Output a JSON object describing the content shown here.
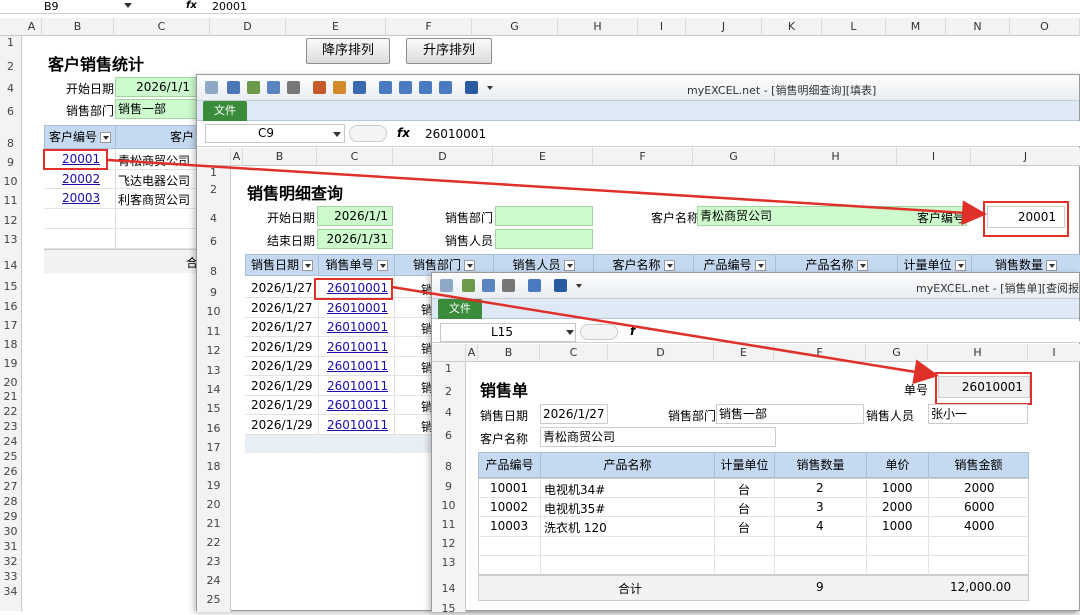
{
  "sheet1": {
    "cell_ref": "B9",
    "formula_value": "20001",
    "columns": [
      "A",
      "B",
      "C",
      "D",
      "E",
      "F",
      "G",
      "H",
      "I",
      "J",
      "K",
      "L",
      "M",
      "N",
      "O"
    ],
    "rows": [
      "1",
      "2",
      "4",
      "6",
      "8",
      "9",
      "10",
      "11",
      "12",
      "13",
      "14",
      "15",
      "16",
      "17",
      "18",
      "19",
      "20",
      "21",
      "22",
      "23",
      "24",
      "25",
      "26",
      "27",
      "28",
      "29",
      "30",
      "31",
      "32",
      "33",
      "34"
    ],
    "title": "客户销售统计",
    "start_label": "开始日期",
    "start_value": "2026/1/1",
    "dept_label": "销售部门",
    "dept_value": "销售一部",
    "btn_desc": "降序排列",
    "btn_asc": "升序排列",
    "hdr_code": "客户编号",
    "hdr_name": "客户",
    "customers": [
      {
        "code": "20001",
        "name": "青松商贸公司"
      },
      {
        "code": "20002",
        "name": "飞达电器公司"
      },
      {
        "code": "20003",
        "name": "利客商贸公司"
      }
    ],
    "total": "合"
  },
  "win2": {
    "title": "myEXCEL.net - [销售明细查询][填表]",
    "file_tab": "文件",
    "cell_ref": "C9",
    "formula_value": "26010001",
    "columns": [
      "A",
      "B",
      "C",
      "D",
      "E",
      "F",
      "G",
      "H",
      "I",
      "J"
    ],
    "rows": [
      "1",
      "2",
      "4",
      "6",
      "8",
      "9",
      "10",
      "11",
      "12",
      "13",
      "14",
      "15",
      "16",
      "17",
      "18",
      "19",
      "20",
      "21",
      "22",
      "23",
      "24",
      "25",
      "26"
    ],
    "title_text": "销售明细查询",
    "start_label": "开始日期",
    "start_value": "2026/1/1",
    "end_label": "结束日期",
    "end_value": "2026/1/31",
    "dept_label": "销售部门",
    "person_label": "销售人员",
    "cust_label": "客户名称",
    "cust_value": "青松商贸公司",
    "code_label": "客户编号",
    "code_value": "20001",
    "headers": [
      "销售日期",
      "销售单号",
      "销售部门",
      "销售人员",
      "客户名称",
      "产品编号",
      "产品名称",
      "计量单位",
      "销售数量"
    ],
    "records": [
      {
        "date": "2026/1/27",
        "no": "26010001",
        "dept": "销"
      },
      {
        "date": "2026/1/27",
        "no": "26010001",
        "dept": "销"
      },
      {
        "date": "2026/1/27",
        "no": "26010001",
        "dept": "销"
      },
      {
        "date": "2026/1/29",
        "no": "26010011",
        "dept": "销"
      },
      {
        "date": "2026/1/29",
        "no": "26010011",
        "dept": "销"
      },
      {
        "date": "2026/1/29",
        "no": "26010011",
        "dept": "销"
      },
      {
        "date": "2026/1/29",
        "no": "26010011",
        "dept": "销"
      },
      {
        "date": "2026/1/29",
        "no": "26010011",
        "dept": "销"
      }
    ]
  },
  "win3": {
    "title": "myEXCEL.net - [销售单][查阅报表",
    "file_tab": "文件",
    "cell_ref": "L15",
    "columns": [
      "A",
      "B",
      "C",
      "D",
      "E",
      "F",
      "G",
      "H",
      "I"
    ],
    "rows": [
      "1",
      "2",
      "4",
      "6",
      "8",
      "9",
      "10",
      "11",
      "12",
      "13",
      "14",
      "15"
    ],
    "title_text": "销售单",
    "no_label": "单号",
    "no_value": "26010001",
    "date_label": "销售日期",
    "date_value": "2026/1/27",
    "dept_label": "销售部门",
    "dept_value": "销售一部",
    "person_label": "销售人员",
    "person_value": "张小一",
    "cust_label": "客户名称",
    "cust_value": "青松商贸公司",
    "headers": [
      "产品编号",
      "产品名称",
      "计量单位",
      "销售数量",
      "单价",
      "销售金额"
    ],
    "items": [
      {
        "code": "10001",
        "name": "电视机34#",
        "unit": "台",
        "qty": "2",
        "price": "1000",
        "amount": "2000"
      },
      {
        "code": "10002",
        "name": "电视机35#",
        "unit": "台",
        "qty": "3",
        "price": "2000",
        "amount": "6000"
      },
      {
        "code": "10003",
        "name": "洗衣机 120",
        "unit": "台",
        "qty": "4",
        "price": "1000",
        "amount": "4000"
      }
    ],
    "total_label": "合计",
    "total_qty": "9",
    "total_amount": "12,000.00"
  },
  "colors": {
    "accent_red": "#e0302a",
    "header_blue": "#c5d9f1",
    "input_green": "#cdfbcd",
    "file_green": "#3a8b3a"
  }
}
